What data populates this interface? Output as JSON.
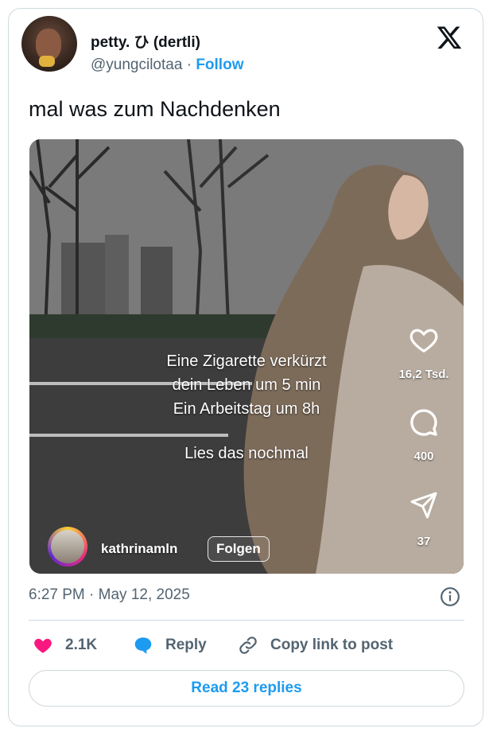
{
  "author": {
    "display_name": "petty. ひ (dertli)",
    "handle": "@yungcilotaa",
    "separator": "·",
    "follow_label": "Follow"
  },
  "tweet": {
    "text": "mal was zum Nachdenken",
    "timestamp": "6:27 PM · May 12, 2025"
  },
  "media": {
    "overlay_lines": [
      "Eine Zigarette verkürzt",
      "dein Leben um 5 min",
      "Ein Arbeitstag um 8h",
      "Lies das nochmal"
    ],
    "like_count": "16,2 Tsd.",
    "comment_count": "400",
    "share_count": "37",
    "reel_username": "kathrinamln",
    "reel_follow_label": "Folgen"
  },
  "actions": {
    "likes": "2.1K",
    "reply_label": "Reply",
    "copy_label": "Copy link to post",
    "read_replies_label": "Read 23 replies"
  },
  "colors": {
    "accent": "#1d9bf0",
    "heart": "#f91880",
    "muted": "#536471"
  },
  "icons": [
    "x-logo-icon",
    "heart-icon",
    "comment-icon",
    "share-icon",
    "like-heart-icon",
    "reply-bubble-icon",
    "link-icon",
    "info-icon"
  ]
}
